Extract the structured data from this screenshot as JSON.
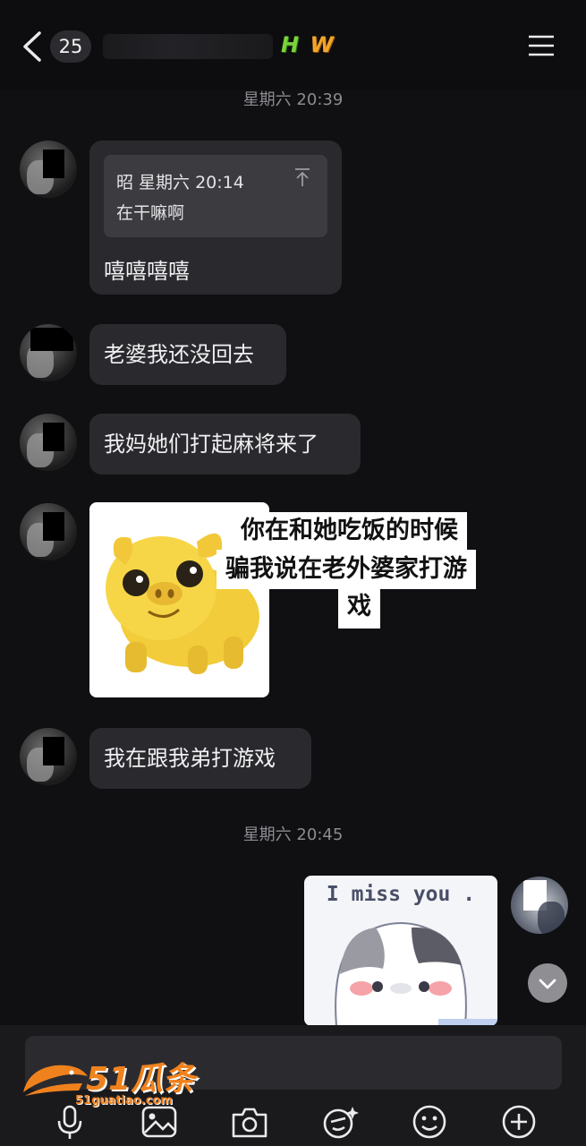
{
  "header": {
    "unread_count": "25",
    "nickname_part1": "H",
    "nickname_part2": "W"
  },
  "timestamps": [
    "星期六 20:39",
    "星期六 20:45"
  ],
  "messages": {
    "m1": {
      "quote_meta": "昭 星期六 20:14",
      "quote_text": "在干嘛啊",
      "text": "嘻嘻嘻嘻"
    },
    "m2": "老婆我还没回去",
    "m3": "我妈她们打起麻将来了",
    "m4": {
      "sticker_caption_line1": "你在和她吃饭的时候",
      "sticker_caption_line2": "骗我说在老外婆家打游",
      "sticker_caption_line3": "戏"
    },
    "m5": "我在跟我弟打游戏",
    "m6": {
      "sticker_text": "I miss you ."
    }
  },
  "watermark": {
    "brand": "51瓜条",
    "url": "51guatiao.com"
  },
  "toolbar": [
    "mic-icon",
    "image-icon",
    "camera-icon",
    "sticker-icon",
    "emoji-icon",
    "plus-icon"
  ],
  "colors": {
    "background": "#101013",
    "bubble": "#2a2a2e",
    "quote": "#3b3b40",
    "timestamp": "#8b8b90"
  }
}
